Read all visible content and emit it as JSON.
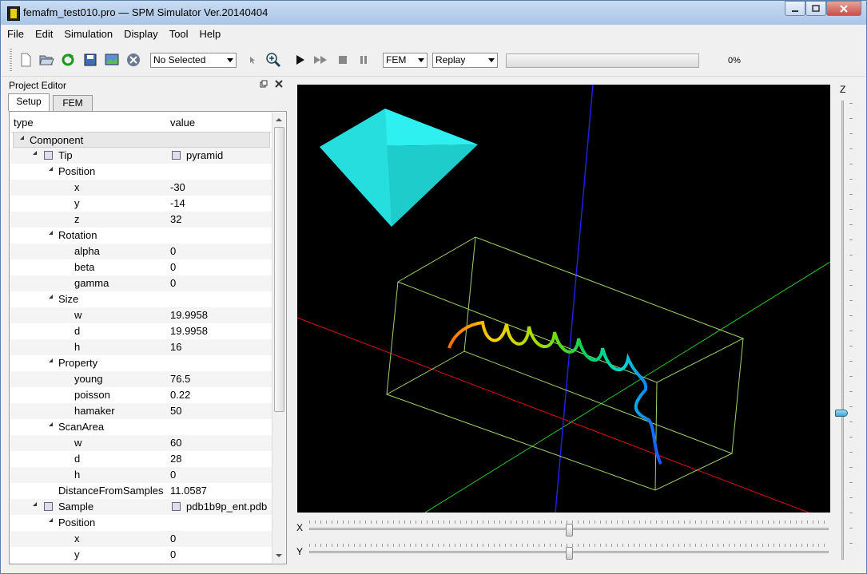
{
  "window": {
    "title": "femafm_test010.pro — SPM Simulator Ver.20140404"
  },
  "menu": [
    "File",
    "Edit",
    "Simulation",
    "Display",
    "Tool",
    "Help"
  ],
  "toolbar": {
    "selection_combo": "No Selected",
    "mode_combo": "FEM",
    "replay_combo": "Replay",
    "progress_value": 0,
    "progress_text": "0%"
  },
  "panel": {
    "title": "Project Editor",
    "tabs": [
      "Setup",
      "FEM"
    ],
    "col_type": "type",
    "col_value": "value",
    "rows": [
      {
        "label": "Component",
        "value": "",
        "indent": 0,
        "group": true
      },
      {
        "label": "Tip",
        "value": "pyramid",
        "indent": 1,
        "icon": true,
        "valicon": true
      },
      {
        "label": "Position",
        "value": "",
        "indent": 2
      },
      {
        "label": "x",
        "value": "-30",
        "indent": 3
      },
      {
        "label": "y",
        "value": "-14",
        "indent": 3
      },
      {
        "label": "z",
        "value": "32",
        "indent": 3
      },
      {
        "label": "Rotation",
        "value": "",
        "indent": 2
      },
      {
        "label": "alpha",
        "value": "0",
        "indent": 3
      },
      {
        "label": "beta",
        "value": "0",
        "indent": 3
      },
      {
        "label": "gamma",
        "value": "0",
        "indent": 3
      },
      {
        "label": "Size",
        "value": "",
        "indent": 2
      },
      {
        "label": "w",
        "value": "19.9958",
        "indent": 3
      },
      {
        "label": "d",
        "value": "19.9958",
        "indent": 3
      },
      {
        "label": "h",
        "value": "16",
        "indent": 3
      },
      {
        "label": "Property",
        "value": "",
        "indent": 2
      },
      {
        "label": "young",
        "value": "76.5",
        "indent": 3
      },
      {
        "label": "poisson",
        "value": "0.22",
        "indent": 3
      },
      {
        "label": "hamaker",
        "value": "50",
        "indent": 3
      },
      {
        "label": "ScanArea",
        "value": "",
        "indent": 2
      },
      {
        "label": "w",
        "value": "60",
        "indent": 3
      },
      {
        "label": "d",
        "value": "28",
        "indent": 3
      },
      {
        "label": "h",
        "value": "0",
        "indent": 3
      },
      {
        "label": "DistanceFromSamples",
        "value": "11.0587",
        "indent": 2,
        "leaf": true
      },
      {
        "label": "Sample",
        "value": "pdb1b9p_ent.pdb",
        "indent": 1,
        "icon": true,
        "valicon": true
      },
      {
        "label": "Position",
        "value": "",
        "indent": 2
      },
      {
        "label": "x",
        "value": "0",
        "indent": 3
      },
      {
        "label": "y",
        "value": "0",
        "indent": 3
      }
    ]
  },
  "sliders": {
    "x_label": "X",
    "y_label": "Y",
    "z_label": "Z",
    "x_value": 0.5,
    "y_value": 0.5,
    "z_value": 0.68
  },
  "colors": {
    "viewport_bg": "#000000",
    "tip": "#22e5e5",
    "box": "#9ed26a",
    "axis_x": "#e01010",
    "axis_y": "#2ec42e",
    "axis_z": "#2020e0"
  }
}
